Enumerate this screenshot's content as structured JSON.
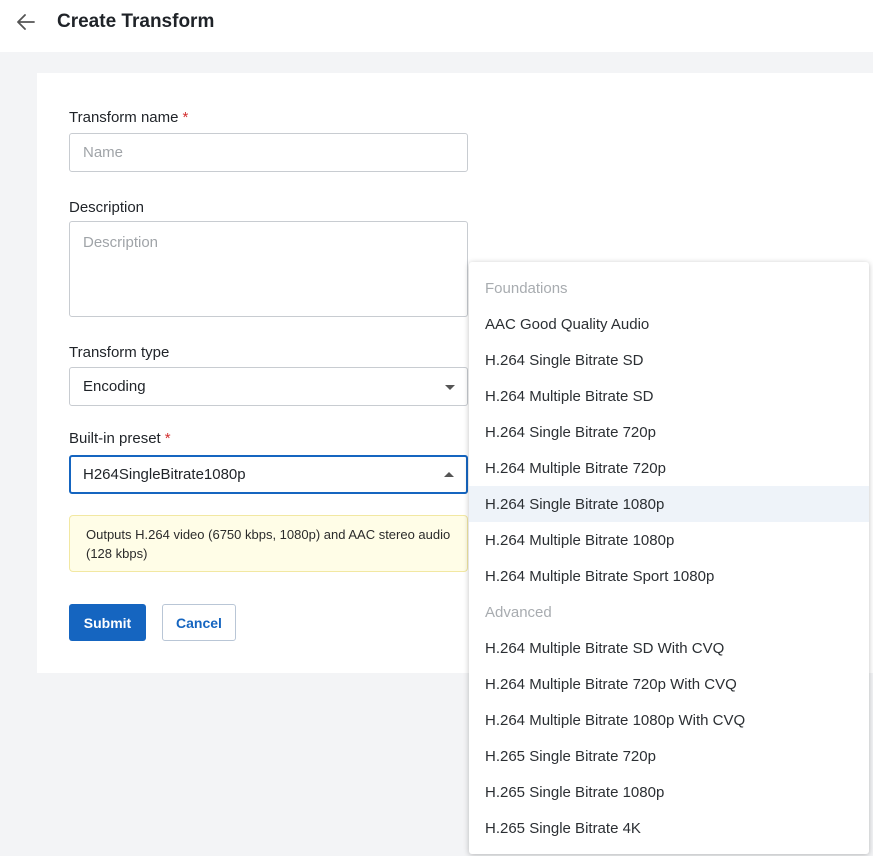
{
  "header": {
    "title": "Create Transform",
    "back_icon": "arrow-left-icon"
  },
  "form": {
    "name": {
      "label": "Transform name",
      "required_mark": "*",
      "placeholder": "Name",
      "value": ""
    },
    "description": {
      "label": "Description",
      "placeholder": "Description",
      "value": ""
    },
    "transform_type": {
      "label": "Transform type",
      "value": "Encoding"
    },
    "preset": {
      "label": "Built-in preset",
      "required_mark": "*",
      "value": "H264SingleBitrate1080p"
    },
    "info": "Outputs H.264 video (6750 kbps, 1080p) and AAC stereo audio (128 kbps)",
    "submit_label": "Submit",
    "cancel_label": "Cancel"
  },
  "dropdown": {
    "rows": [
      {
        "type": "group",
        "label": "Foundations"
      },
      {
        "type": "option",
        "label": "AAC Good Quality Audio"
      },
      {
        "type": "option",
        "label": "H.264 Single Bitrate SD"
      },
      {
        "type": "option",
        "label": "H.264 Multiple Bitrate SD"
      },
      {
        "type": "option",
        "label": "H.264 Single Bitrate 720p"
      },
      {
        "type": "option",
        "label": "H.264 Multiple Bitrate 720p"
      },
      {
        "type": "option",
        "label": "H.264 Single Bitrate 1080p",
        "selected": true
      },
      {
        "type": "option",
        "label": "H.264 Multiple Bitrate 1080p"
      },
      {
        "type": "option",
        "label": "H.264 Multiple Bitrate Sport 1080p"
      },
      {
        "type": "group",
        "label": "Advanced"
      },
      {
        "type": "option",
        "label": "H.264 Multiple Bitrate SD With CVQ"
      },
      {
        "type": "option",
        "label": "H.264 Multiple Bitrate 720p With CVQ"
      },
      {
        "type": "option",
        "label": "H.264 Multiple Bitrate 1080p With CVQ"
      },
      {
        "type": "option",
        "label": "H.265 Single Bitrate 720p"
      },
      {
        "type": "option",
        "label": "H.265 Single Bitrate 1080p"
      },
      {
        "type": "option",
        "label": "H.265 Single Bitrate 4K"
      }
    ]
  },
  "colors": {
    "accent": "#1565c0",
    "required": "#d32f2f",
    "info_bg": "#fffde7",
    "selected_row": "#eef3f9"
  }
}
